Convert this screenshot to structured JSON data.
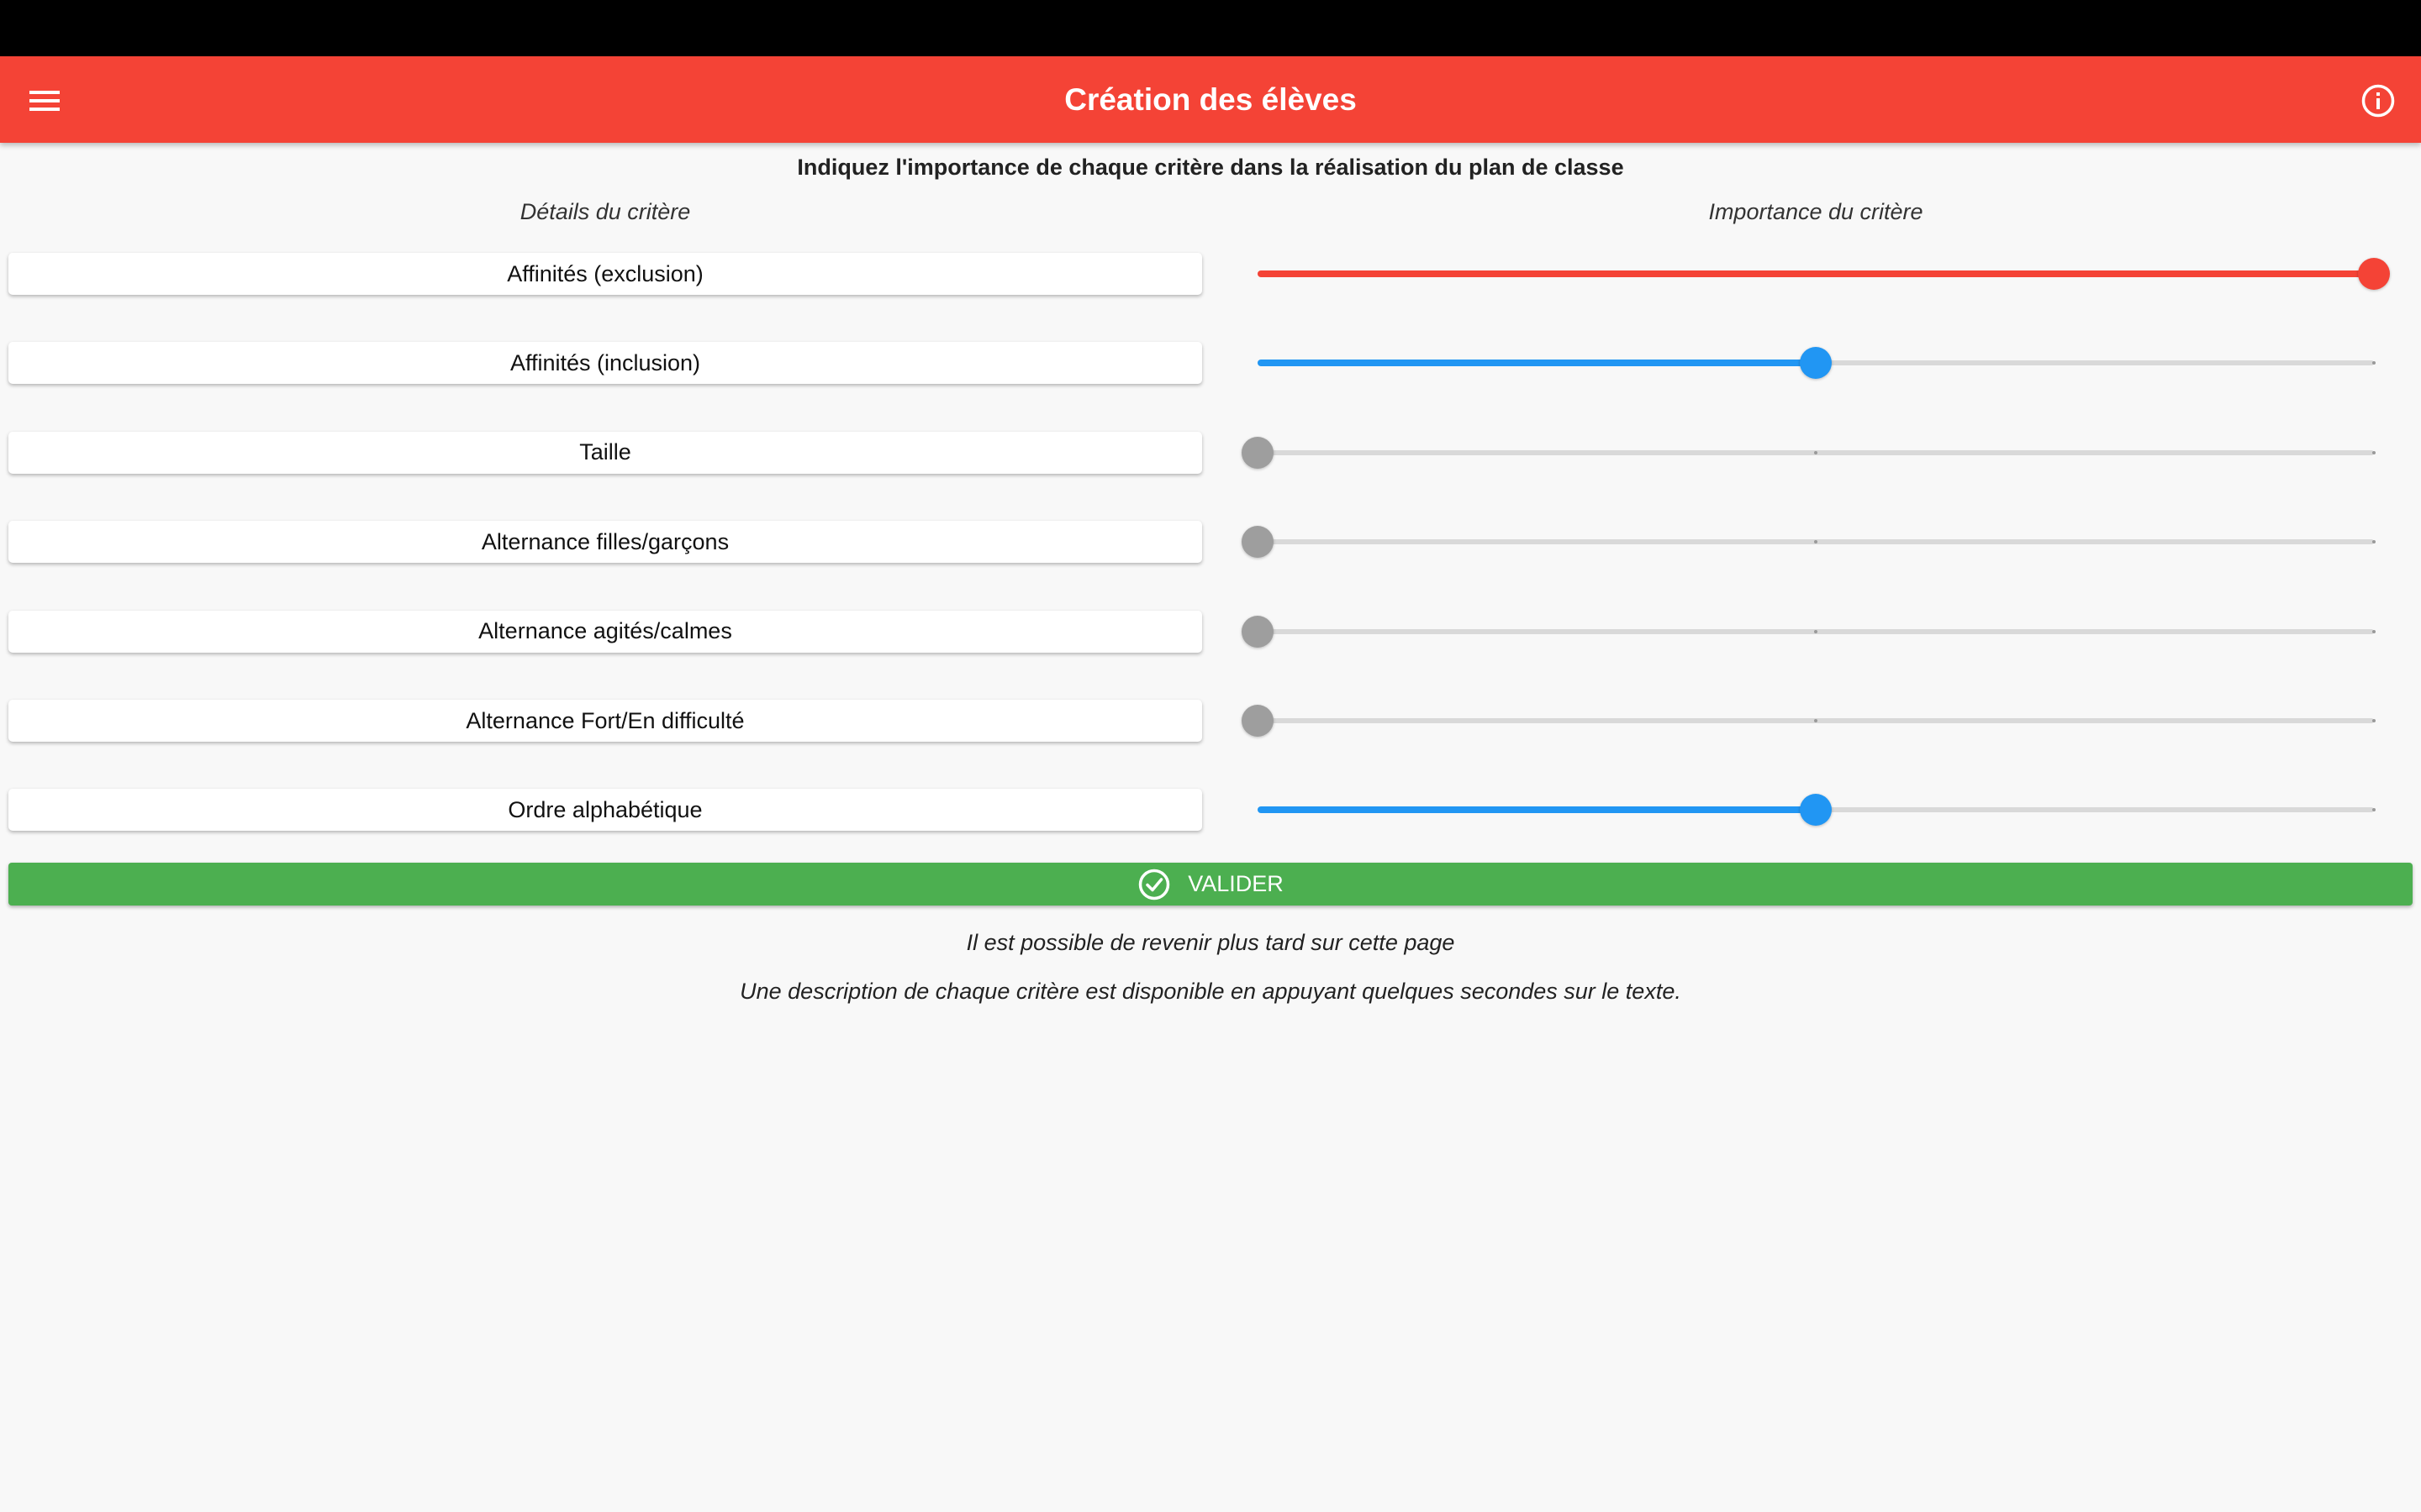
{
  "app_bar": {
    "title": "Création des élèves",
    "menu_icon": "menu-icon",
    "info_icon": "info-icon",
    "color": "#f44336"
  },
  "instruction": "Indiquez l'importance de chaque critère dans la réalisation du plan de classe",
  "columns": {
    "details": "Détails du critère",
    "importance": "Importance du critère"
  },
  "criteria": [
    {
      "label": "Affinités (exclusion)",
      "value": 1.0,
      "color": "#f44336"
    },
    {
      "label": "Affinités (inclusion)",
      "value": 0.5,
      "color": "#2196f3"
    },
    {
      "label": "Taille",
      "value": 0.0,
      "color": "#9e9e9e"
    },
    {
      "label": "Alternance filles/garçons",
      "value": 0.0,
      "color": "#9e9e9e"
    },
    {
      "label": "Alternance agités/calmes",
      "value": 0.0,
      "color": "#9e9e9e"
    },
    {
      "label": "Alternance Fort/En difficulté",
      "value": 0.0,
      "color": "#9e9e9e"
    },
    {
      "label": "Ordre alphabétique",
      "value": 0.5,
      "color": "#2196f3"
    }
  ],
  "validate": {
    "label": "VALIDER",
    "icon": "check-circle-icon",
    "color": "#4caf50"
  },
  "notes": {
    "later": "Il est possible de revenir plus tard sur cette page",
    "description": "Une description de chaque critère est disponible en appuyant quelques secondes sur le texte."
  }
}
